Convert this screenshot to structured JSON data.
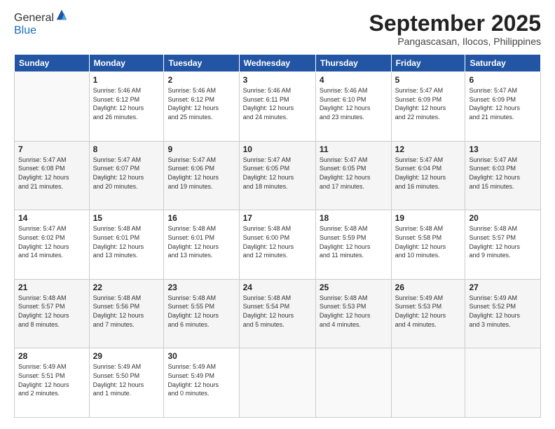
{
  "header": {
    "logo_general": "General",
    "logo_blue": "Blue",
    "cal_title": "September 2025",
    "cal_subtitle": "Pangascasan, Ilocos, Philippines"
  },
  "weekdays": [
    "Sunday",
    "Monday",
    "Tuesday",
    "Wednesday",
    "Thursday",
    "Friday",
    "Saturday"
  ],
  "weeks": [
    [
      {
        "day": "",
        "info": ""
      },
      {
        "day": "1",
        "info": "Sunrise: 5:46 AM\nSunset: 6:12 PM\nDaylight: 12 hours\nand 26 minutes."
      },
      {
        "day": "2",
        "info": "Sunrise: 5:46 AM\nSunset: 6:12 PM\nDaylight: 12 hours\nand 25 minutes."
      },
      {
        "day": "3",
        "info": "Sunrise: 5:46 AM\nSunset: 6:11 PM\nDaylight: 12 hours\nand 24 minutes."
      },
      {
        "day": "4",
        "info": "Sunrise: 5:46 AM\nSunset: 6:10 PM\nDaylight: 12 hours\nand 23 minutes."
      },
      {
        "day": "5",
        "info": "Sunrise: 5:47 AM\nSunset: 6:09 PM\nDaylight: 12 hours\nand 22 minutes."
      },
      {
        "day": "6",
        "info": "Sunrise: 5:47 AM\nSunset: 6:09 PM\nDaylight: 12 hours\nand 21 minutes."
      }
    ],
    [
      {
        "day": "7",
        "info": "Sunrise: 5:47 AM\nSunset: 6:08 PM\nDaylight: 12 hours\nand 21 minutes."
      },
      {
        "day": "8",
        "info": "Sunrise: 5:47 AM\nSunset: 6:07 PM\nDaylight: 12 hours\nand 20 minutes."
      },
      {
        "day": "9",
        "info": "Sunrise: 5:47 AM\nSunset: 6:06 PM\nDaylight: 12 hours\nand 19 minutes."
      },
      {
        "day": "10",
        "info": "Sunrise: 5:47 AM\nSunset: 6:05 PM\nDaylight: 12 hours\nand 18 minutes."
      },
      {
        "day": "11",
        "info": "Sunrise: 5:47 AM\nSunset: 6:05 PM\nDaylight: 12 hours\nand 17 minutes."
      },
      {
        "day": "12",
        "info": "Sunrise: 5:47 AM\nSunset: 6:04 PM\nDaylight: 12 hours\nand 16 minutes."
      },
      {
        "day": "13",
        "info": "Sunrise: 5:47 AM\nSunset: 6:03 PM\nDaylight: 12 hours\nand 15 minutes."
      }
    ],
    [
      {
        "day": "14",
        "info": "Sunrise: 5:47 AM\nSunset: 6:02 PM\nDaylight: 12 hours\nand 14 minutes."
      },
      {
        "day": "15",
        "info": "Sunrise: 5:48 AM\nSunset: 6:01 PM\nDaylight: 12 hours\nand 13 minutes."
      },
      {
        "day": "16",
        "info": "Sunrise: 5:48 AM\nSunset: 6:01 PM\nDaylight: 12 hours\nand 13 minutes."
      },
      {
        "day": "17",
        "info": "Sunrise: 5:48 AM\nSunset: 6:00 PM\nDaylight: 12 hours\nand 12 minutes."
      },
      {
        "day": "18",
        "info": "Sunrise: 5:48 AM\nSunset: 5:59 PM\nDaylight: 12 hours\nand 11 minutes."
      },
      {
        "day": "19",
        "info": "Sunrise: 5:48 AM\nSunset: 5:58 PM\nDaylight: 12 hours\nand 10 minutes."
      },
      {
        "day": "20",
        "info": "Sunrise: 5:48 AM\nSunset: 5:57 PM\nDaylight: 12 hours\nand 9 minutes."
      }
    ],
    [
      {
        "day": "21",
        "info": "Sunrise: 5:48 AM\nSunset: 5:57 PM\nDaylight: 12 hours\nand 8 minutes."
      },
      {
        "day": "22",
        "info": "Sunrise: 5:48 AM\nSunset: 5:56 PM\nDaylight: 12 hours\nand 7 minutes."
      },
      {
        "day": "23",
        "info": "Sunrise: 5:48 AM\nSunset: 5:55 PM\nDaylight: 12 hours\nand 6 minutes."
      },
      {
        "day": "24",
        "info": "Sunrise: 5:48 AM\nSunset: 5:54 PM\nDaylight: 12 hours\nand 5 minutes."
      },
      {
        "day": "25",
        "info": "Sunrise: 5:48 AM\nSunset: 5:53 PM\nDaylight: 12 hours\nand 4 minutes."
      },
      {
        "day": "26",
        "info": "Sunrise: 5:49 AM\nSunset: 5:53 PM\nDaylight: 12 hours\nand 4 minutes."
      },
      {
        "day": "27",
        "info": "Sunrise: 5:49 AM\nSunset: 5:52 PM\nDaylight: 12 hours\nand 3 minutes."
      }
    ],
    [
      {
        "day": "28",
        "info": "Sunrise: 5:49 AM\nSunset: 5:51 PM\nDaylight: 12 hours\nand 2 minutes."
      },
      {
        "day": "29",
        "info": "Sunrise: 5:49 AM\nSunset: 5:50 PM\nDaylight: 12 hours\nand 1 minute."
      },
      {
        "day": "30",
        "info": "Sunrise: 5:49 AM\nSunset: 5:49 PM\nDaylight: 12 hours\nand 0 minutes."
      },
      {
        "day": "",
        "info": ""
      },
      {
        "day": "",
        "info": ""
      },
      {
        "day": "",
        "info": ""
      },
      {
        "day": "",
        "info": ""
      }
    ]
  ]
}
